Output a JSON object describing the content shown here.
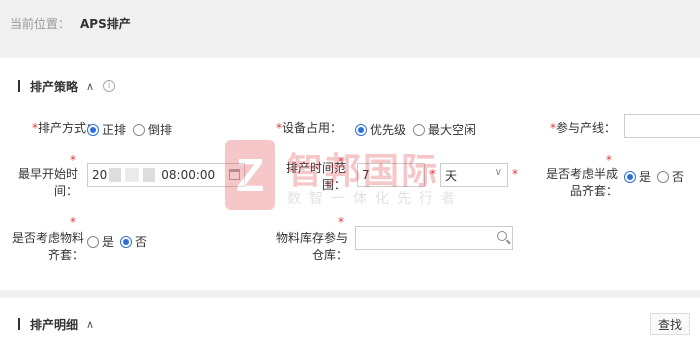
{
  "breadcrumb": {
    "prefix": "当前位置：",
    "current": "APS排产"
  },
  "section1": {
    "title": "排产策略",
    "chevron": "∧",
    "info": "i"
  },
  "form": {
    "method": {
      "label": "排产方式：",
      "options": [
        "正排",
        "倒排"
      ],
      "selected": "正排"
    },
    "equipment": {
      "label": "设备占用：",
      "options": [
        "优先级",
        "最大空闲"
      ],
      "selected": "优先级"
    },
    "line": {
      "label": "参与产线：",
      "value": ""
    },
    "earliest": {
      "label_1": "最早开始时",
      "label_2": "间：",
      "value_prefix": "20",
      "value_time": "08:00:00"
    },
    "range": {
      "label_1": "排产时间范",
      "label_2": "围：",
      "value": "7",
      "unit": "天"
    },
    "semi": {
      "label_1": "是否考虑半成",
      "label_2": "品齐套：",
      "options": [
        "是",
        "否"
      ],
      "selected": "是"
    },
    "material": {
      "label_1": "是否考虑物料",
      "label_2": "齐套：",
      "options": [
        "是",
        "否"
      ],
      "selected": "否"
    },
    "warehouse": {
      "label_1": "物料库存参与",
      "label_2": "仓库：",
      "value": ""
    },
    "required_mark": "*"
  },
  "section2": {
    "title": "排产明细",
    "chevron": "∧"
  },
  "buttons": {
    "search": "查找"
  },
  "watermark": {
    "logo": "Z",
    "title": "智邦国际",
    "subtitle": "数智一体化先行者"
  }
}
